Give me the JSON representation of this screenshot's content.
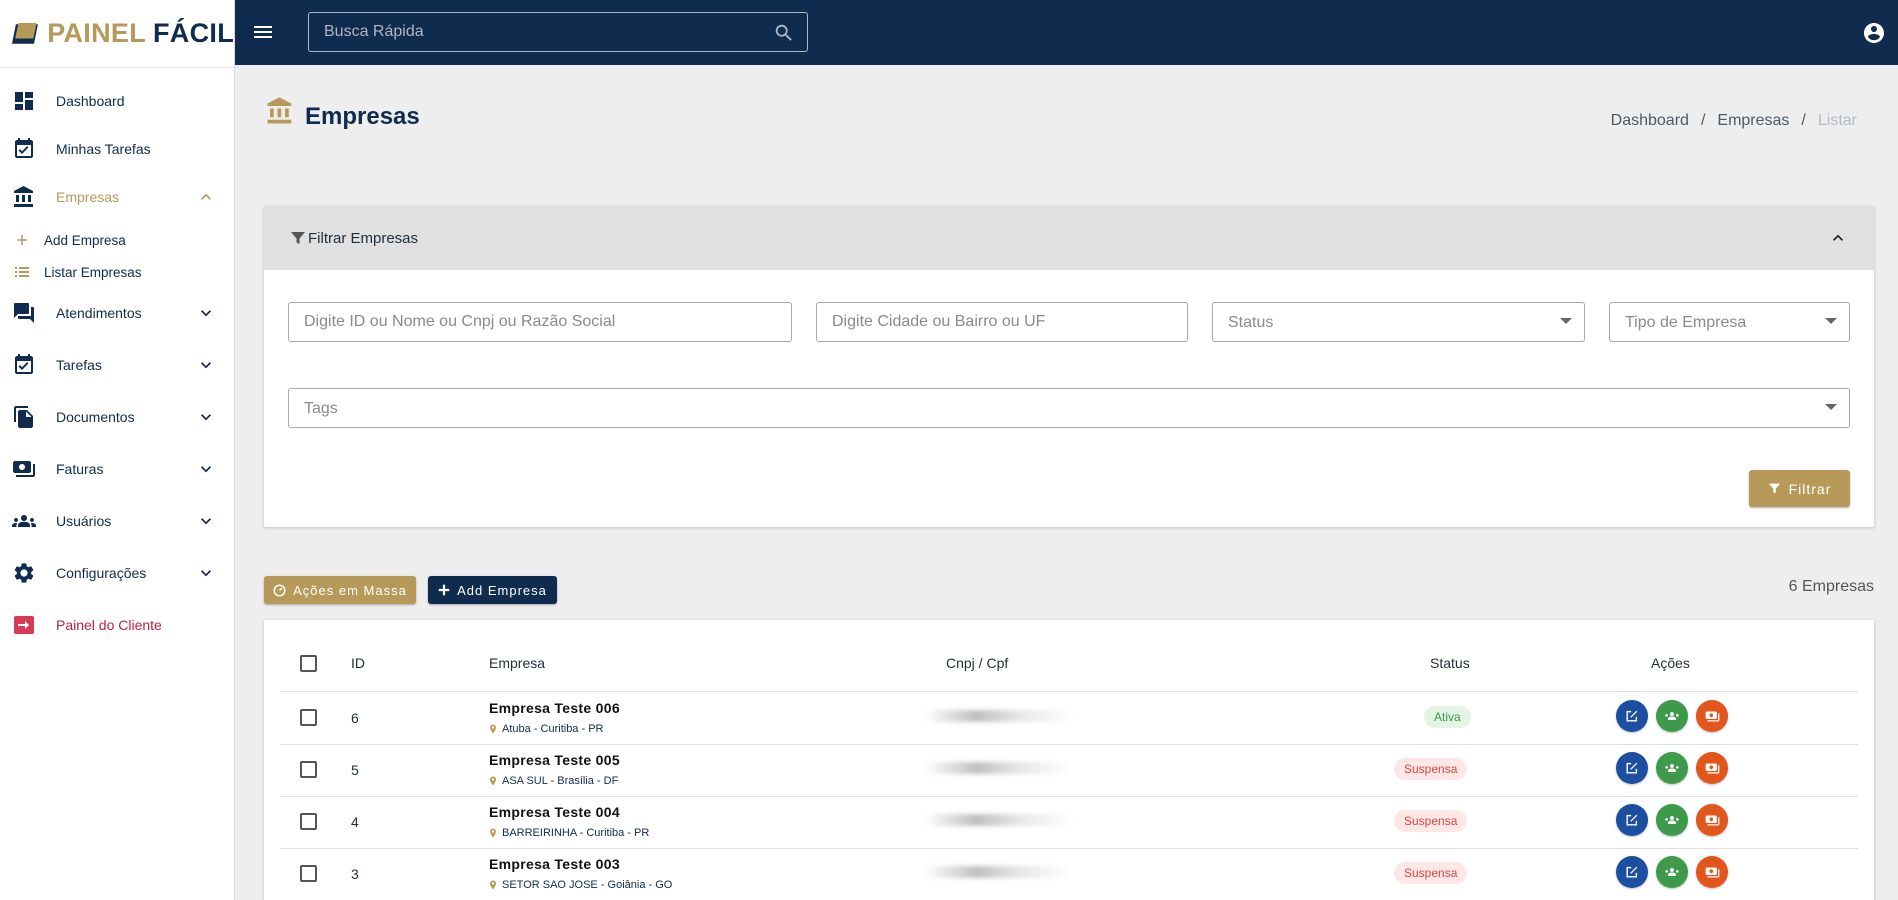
{
  "app": {
    "logo_part1": "PAINEL",
    "logo_part2": "FÁCIL"
  },
  "sidebar": {
    "items": [
      {
        "label": "Dashboard"
      },
      {
        "label": "Minhas Tarefas"
      },
      {
        "label": "Empresas"
      },
      {
        "label": "Atendimentos"
      },
      {
        "label": "Tarefas"
      },
      {
        "label": "Documentos"
      },
      {
        "label": "Faturas"
      },
      {
        "label": "Usuários"
      },
      {
        "label": "Configurações"
      },
      {
        "label": "Painel do Cliente"
      }
    ],
    "subitems": [
      {
        "label": "Add Empresa"
      },
      {
        "label": "Listar Empresas"
      }
    ]
  },
  "topbar": {
    "search_placeholder": "Busca Rápida"
  },
  "page": {
    "title": "Empresas",
    "breadcrumb": [
      "Dashboard",
      "Empresas",
      "Listar"
    ],
    "breadcrumb_sep": "/"
  },
  "filter": {
    "title": "Filtrar Empresas",
    "name_placeholder": "Digite ID ou Nome ou Cnpj ou Razão Social",
    "city_placeholder": "Digite Cidade ou Bairro ou UF",
    "status_placeholder": "Status",
    "type_placeholder": "Tipo de Empresa",
    "tags_placeholder": "Tags",
    "button": "Filtrar"
  },
  "actions": {
    "bulk": "Ações em Massa",
    "add": "Add Empresa",
    "count": "6 Empresas"
  },
  "table": {
    "headers": {
      "id": "ID",
      "empresa": "Empresa",
      "cnpj": "Cnpj / Cpf",
      "status": "Status",
      "acoes": "Ações"
    },
    "rows": [
      {
        "id": "6",
        "name": "Empresa Teste 006",
        "location": "Atuba - Curitiba - PR",
        "status": "Ativa"
      },
      {
        "id": "5",
        "name": "Empresa Teste 005",
        "location": "ASA SUL - Brasília - DF",
        "status": "Suspensa"
      },
      {
        "id": "4",
        "name": "Empresa Teste 004",
        "location": "BARREIRINHA - Curitiba - PR",
        "status": "Suspensa"
      },
      {
        "id": "3",
        "name": "Empresa Teste 003",
        "location": "SETOR SAO JOSE - Goiânia - GO",
        "status": "Suspensa"
      }
    ]
  },
  "colors": {
    "navy": "#0f2c4f",
    "gold": "#b79a5a",
    "active_green": "#3c9a47",
    "suspended_red": "#e1443f",
    "action_blue": "#1d4fa1",
    "action_green": "#3d9a4a",
    "action_orange": "#e2561c"
  }
}
